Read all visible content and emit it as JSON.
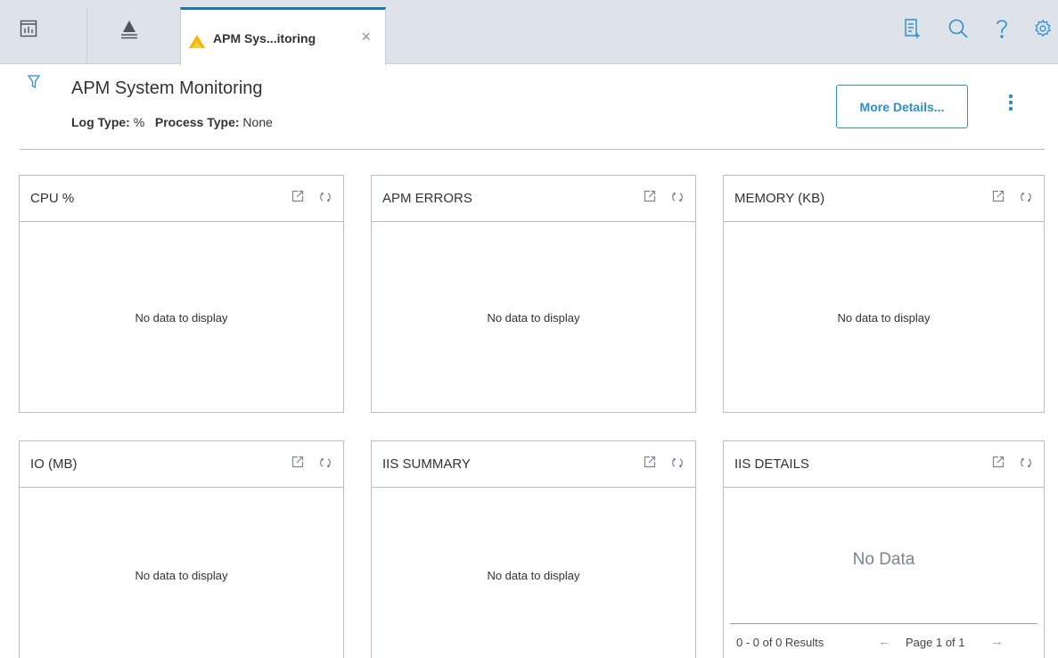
{
  "tabs": {
    "active_tab_title": "APM Sys...itoring",
    "close_glyph": "×"
  },
  "header": {
    "title": "APM System Monitoring",
    "filters": [
      {
        "label": "Log Type:",
        "value": "%"
      },
      {
        "label": "Process Type:",
        "value": "None"
      }
    ],
    "more_details_label": "More Details..."
  },
  "widgets": [
    {
      "title": "CPU %",
      "message": "No data to display"
    },
    {
      "title": "APM ERRORS",
      "message": "No data to display"
    },
    {
      "title": "MEMORY (KB)",
      "message": "No data to display"
    },
    {
      "title": "IO (MB)",
      "message": "No data to display"
    },
    {
      "title": "IIS SUMMARY",
      "message": "No data to display"
    },
    {
      "title": "IIS DETAILS",
      "message": "No Data"
    }
  ],
  "pager": {
    "results": "0 - 0 of 0 Results",
    "page": "Page 1 of 1",
    "prev_glyph": "←",
    "next_glyph": "→"
  },
  "colors": {
    "accent": "#2c8fd0",
    "active_tab_border": "#1d7aa8",
    "warning": "#f5b700",
    "tabbar_bg": "#dde3e8"
  },
  "icons": [
    "dashboard-icon",
    "asset-hierarchy-icon",
    "warning-icon",
    "close-icon",
    "notes-icon",
    "search-icon",
    "help-icon",
    "settings-icon",
    "filter-icon",
    "kebab-menu-icon",
    "popout-icon",
    "refresh-icon"
  ]
}
